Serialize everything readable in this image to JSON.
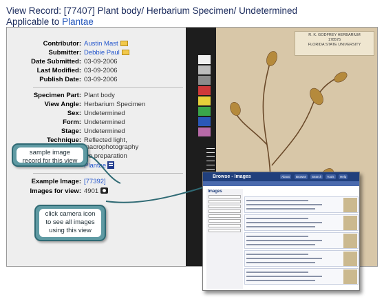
{
  "header": {
    "title_prefix": "View Record: [77407] Plant body/ Herbarium Specimen/ Undetermined",
    "applicable_prefix": "Applicable to ",
    "applicable_link": "Plantae"
  },
  "record": {
    "contributor": {
      "label": "Contributor:",
      "value": "Austin Mast",
      "icon": "mail-icon"
    },
    "submitter": {
      "label": "Submitter:",
      "value": "Debbie Paul",
      "icon": "mail-icon"
    },
    "date_submitted": {
      "label": "Date Submitted:",
      "value": "03-09-2006"
    },
    "last_modified": {
      "label": "Last Modified:",
      "value": "03-09-2006"
    },
    "publish_date": {
      "label": "Publish Date:",
      "value": "03-09-2006"
    },
    "specimen_part": {
      "label": "Specimen Part:",
      "value": "Plant body"
    },
    "view_angle": {
      "label": "View Angle:",
      "value": "Herbarium Specimen"
    },
    "sex": {
      "label": "Sex:",
      "value": "Undetermined"
    },
    "form": {
      "label": "Form:",
      "value": "Undetermined"
    },
    "stage": {
      "label": "Stage:",
      "value": "Undetermined"
    },
    "technique": {
      "label": "Technique:",
      "value_line1": "Reflected light,",
      "value_line2": "macrophotography"
    },
    "preparation": {
      "value": "No preparation"
    },
    "taxon": {
      "value": "Plantae",
      "icon": "taxon-tree-icon"
    },
    "example_image": {
      "label": "Example Image:",
      "value": "[77392]"
    },
    "images_for_view": {
      "label": "Images for view:",
      "value": "4901",
      "icon": "camera-icon"
    }
  },
  "callouts": {
    "sample": {
      "line1": "sample image",
      "line2": "record for this view"
    },
    "camera": {
      "line1": "click camera icon",
      "line2": "to see all images",
      "line3": "using this view"
    }
  },
  "specimen_label": {
    "line1": "R. K. GODFREY HERBARIUM",
    "line2": "178575",
    "line3": "FLORIDA STATE UNIVERSITY"
  },
  "browse_window": {
    "title": "Browse - Images",
    "nav": [
      "About",
      "Browse",
      "Search",
      "Tools",
      "Help"
    ],
    "panel_title": "Images"
  },
  "colors": {
    "title": "#1a2a5c",
    "link": "#2255cc",
    "callout_border": "#2f6a74",
    "callout_fill": "#5f9aa3",
    "browse_header": "#203f7c"
  }
}
